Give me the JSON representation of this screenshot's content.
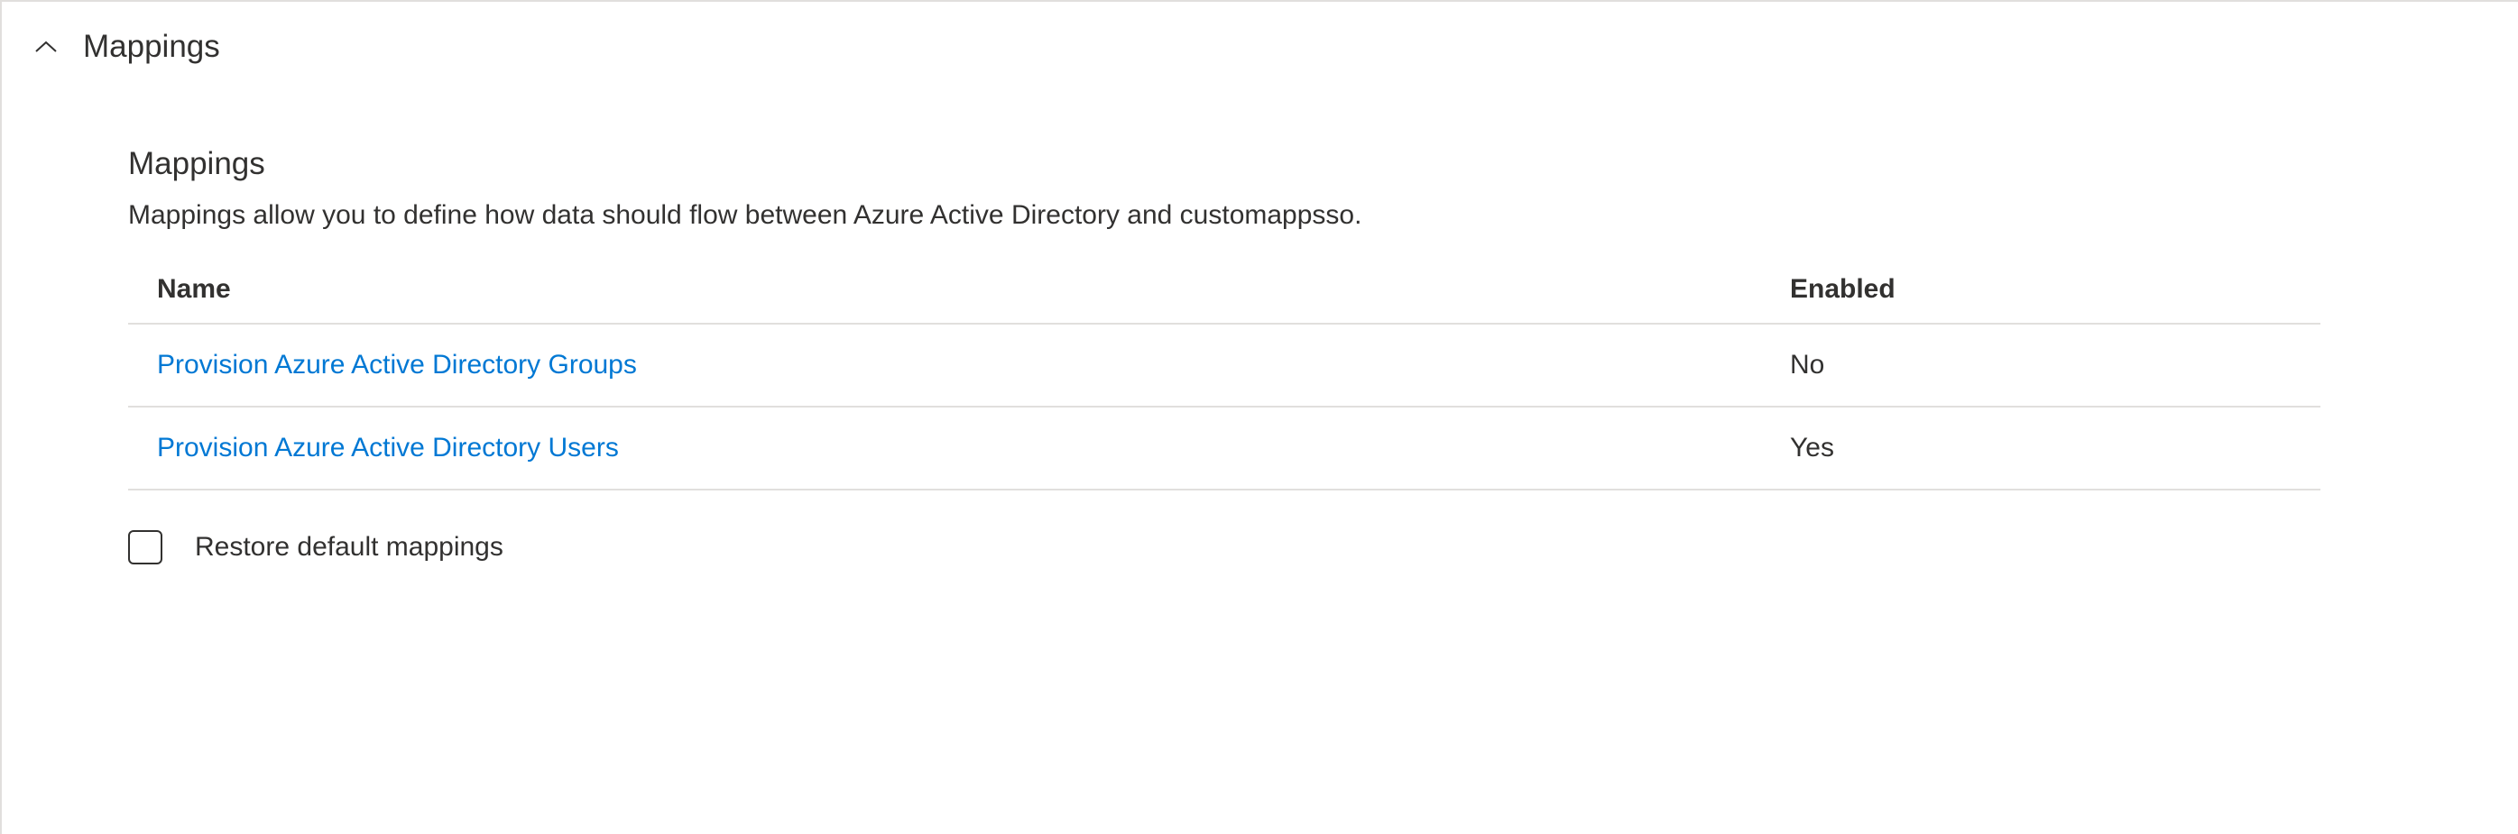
{
  "section": {
    "title": "Mappings",
    "subheading": "Mappings",
    "description": "Mappings allow you to define how data should flow between Azure Active Directory and customappsso."
  },
  "table": {
    "headers": {
      "name": "Name",
      "enabled": "Enabled"
    },
    "rows": [
      {
        "name": "Provision Azure Active Directory Groups",
        "enabled": "No"
      },
      {
        "name": "Provision Azure Active Directory Users",
        "enabled": "Yes"
      }
    ]
  },
  "restore": {
    "label": "Restore default mappings"
  }
}
